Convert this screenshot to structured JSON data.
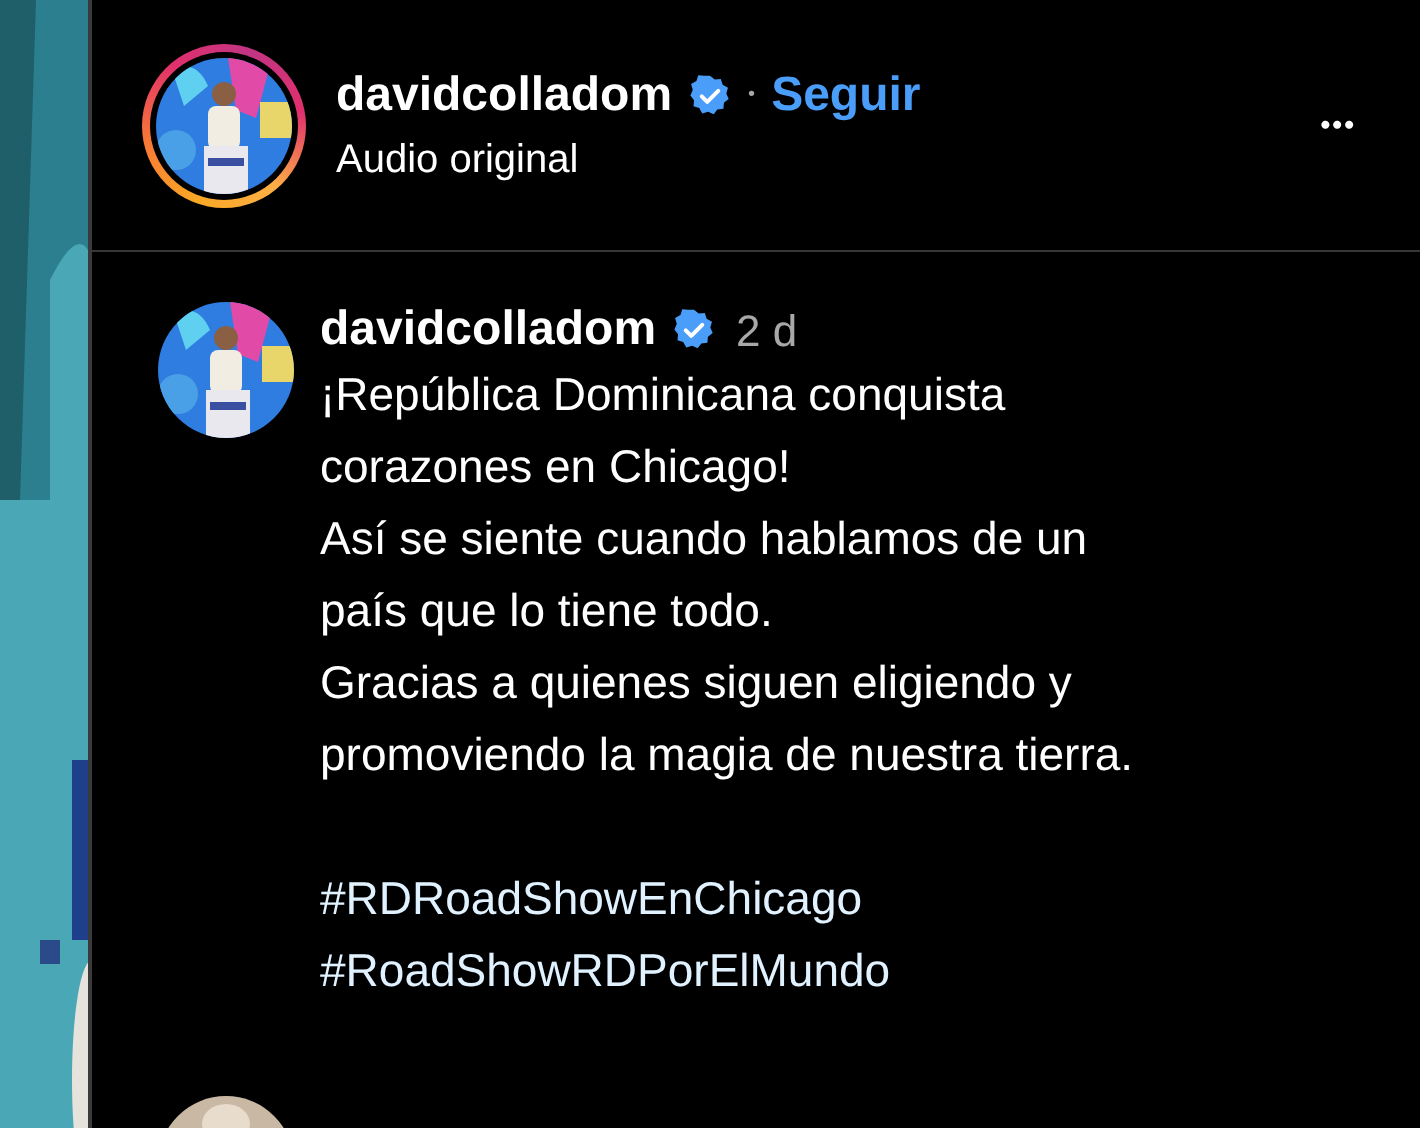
{
  "header": {
    "username": "davidcolladom",
    "verified": true,
    "separator": "•",
    "follow_label": "Seguir",
    "subtitle": "Audio original",
    "story_ring": true,
    "more_label": "•••"
  },
  "comment": {
    "username": "davidcolladom",
    "verified": true,
    "time": "2 d",
    "caption": [
      "¡República Dominicana conquista",
      "corazones en Chicago!",
      "Así se siente cuando hablamos de un",
      "país que lo tiene todo.",
      "Gracias a quienes siguen eligiendo y",
      "promoviendo la magia de nuestra tierra."
    ],
    "hashtags": [
      "#RDRoadShowEnChicago",
      "#RoadShowRDPorElMundo"
    ]
  }
}
